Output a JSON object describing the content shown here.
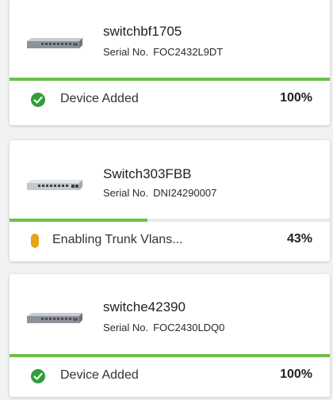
{
  "devices": [
    {
      "name": "switchbf1705",
      "serial_label": "Serial No.",
      "serial": "FOC2432L9DT",
      "status": "Device Added",
      "status_icon": "check-circle-icon",
      "progress": 100,
      "percent": "100%",
      "status_color": "#2e9e3a"
    },
    {
      "name": "Switch303FBB",
      "serial_label": "Serial No.",
      "serial": "DNI24290007",
      "status": "Enabling Trunk Vlans...",
      "status_icon": "pending-pill-icon",
      "progress": 43,
      "percent": "43%",
      "status_color": "#e8a317"
    },
    {
      "name": "switche42390",
      "serial_label": "Serial No.",
      "serial": "FOC2430LDQ0",
      "status": "Device Added",
      "status_icon": "check-circle-icon",
      "progress": 100,
      "percent": "100%",
      "status_color": "#2e9e3a"
    }
  ],
  "colors": {
    "progress_fill": "#6cc04a",
    "progress_track": "#ebebeb"
  }
}
